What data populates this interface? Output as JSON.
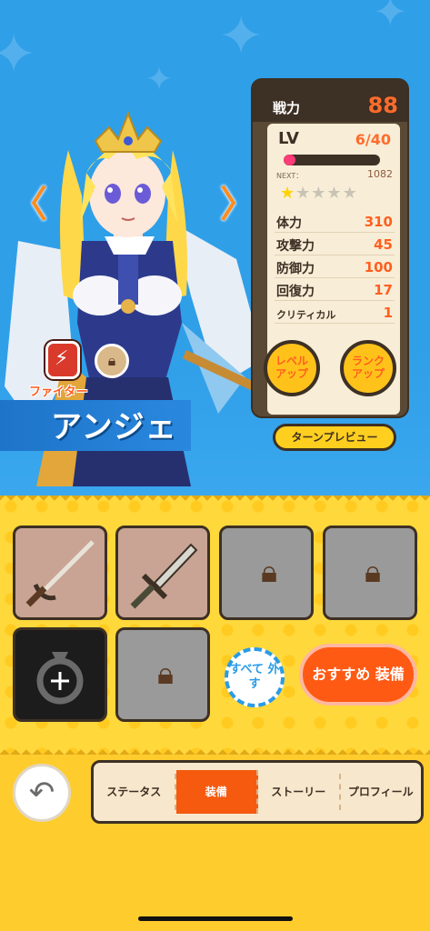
{
  "nav": {
    "prev_symbol": "〈",
    "next_symbol": "〉"
  },
  "stats": {
    "power_label": "戦力",
    "power_value": "88",
    "lv_label": "LV",
    "lv_value": "6/40",
    "exp_fraction": 0.12,
    "next_label": "NEXT：",
    "next_value": "1082",
    "rank_stars": 1,
    "rank_stars_max": 5,
    "rows": [
      {
        "label": "体力",
        "value": "310"
      },
      {
        "label": "攻撃力",
        "value": "45"
      },
      {
        "label": "防御力",
        "value": "100"
      },
      {
        "label": "回復力",
        "value": "17"
      },
      {
        "label": "クリティカル",
        "value": "1"
      }
    ],
    "level_up_label": "レベル アップ",
    "rank_up_label": "ランク アップ",
    "turn_preview_label": "ターンプレビュー"
  },
  "character": {
    "class_label": "ファイター",
    "name": "アンジェ"
  },
  "equipment": {
    "unequip_all_label": "すべて 外す",
    "recommend_label": "おすすめ 装備"
  },
  "tabs": [
    {
      "label": "ステータス",
      "active": false
    },
    {
      "label": "装備",
      "active": true
    },
    {
      "label": "ストーリー",
      "active": false
    },
    {
      "label": "プロフィール",
      "active": false
    }
  ],
  "icons": {
    "back": "undo-arrow-icon",
    "lock": "padlock-icon",
    "class": "sword-shield-icon"
  },
  "colors": {
    "accent_orange": "#ff5f1f",
    "panel_brown": "#3d3024",
    "sky_blue": "#2f9fe8",
    "panel_yellow": "#ffd83b"
  }
}
